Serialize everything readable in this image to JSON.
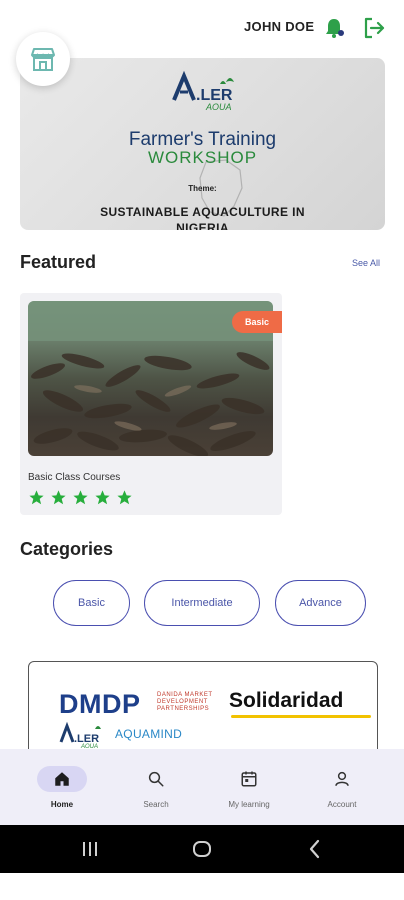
{
  "header": {
    "username": "JOHN DOE",
    "icons": {
      "store": "store-icon",
      "bell": "bell-icon",
      "logout": "logout-icon"
    }
  },
  "banner": {
    "brand": "ALLER",
    "brand_sub": "AQUA",
    "line1": "Farmer's Training",
    "line2": "WORKSHOP",
    "theme_label": "Theme:",
    "line3": "SUSTAINABLE AQUACULTURE IN",
    "line4": "NIGERIA"
  },
  "featured": {
    "title": "Featured",
    "see_all": "See All",
    "courses": [
      {
        "title": "Basic Class Courses",
        "badge": "Basic",
        "rating": 5
      }
    ]
  },
  "categories": {
    "title": "Categories",
    "items": [
      "Basic",
      "Intermediate",
      "Advance"
    ]
  },
  "partners": {
    "dmdp": "DMDP",
    "dmdp_sub_1": "DANIDA MARKET",
    "dmdp_sub_2": "DEVELOPMENT",
    "dmdp_sub_3": "PARTNERSHIPS",
    "solidaridad": "Solidaridad",
    "aller": "ALLER",
    "aller_sub": "AQUA",
    "aquamind": "AQUAMIND"
  },
  "bottom_nav": {
    "items": [
      {
        "label": "Home",
        "icon": "home-icon",
        "active": true
      },
      {
        "label": "Search",
        "icon": "search-icon",
        "active": false
      },
      {
        "label": "My learning",
        "icon": "calendar-icon",
        "active": false
      },
      {
        "label": "Account",
        "icon": "user-icon",
        "active": false
      }
    ]
  },
  "system_nav": {
    "icons": [
      "recents-icon",
      "home-circle-icon",
      "back-icon"
    ]
  },
  "colors": {
    "accent": "#4a4fb0",
    "star": "#27ae3c",
    "badge": "#ef6b46",
    "nav_bg": "#efeef8"
  }
}
